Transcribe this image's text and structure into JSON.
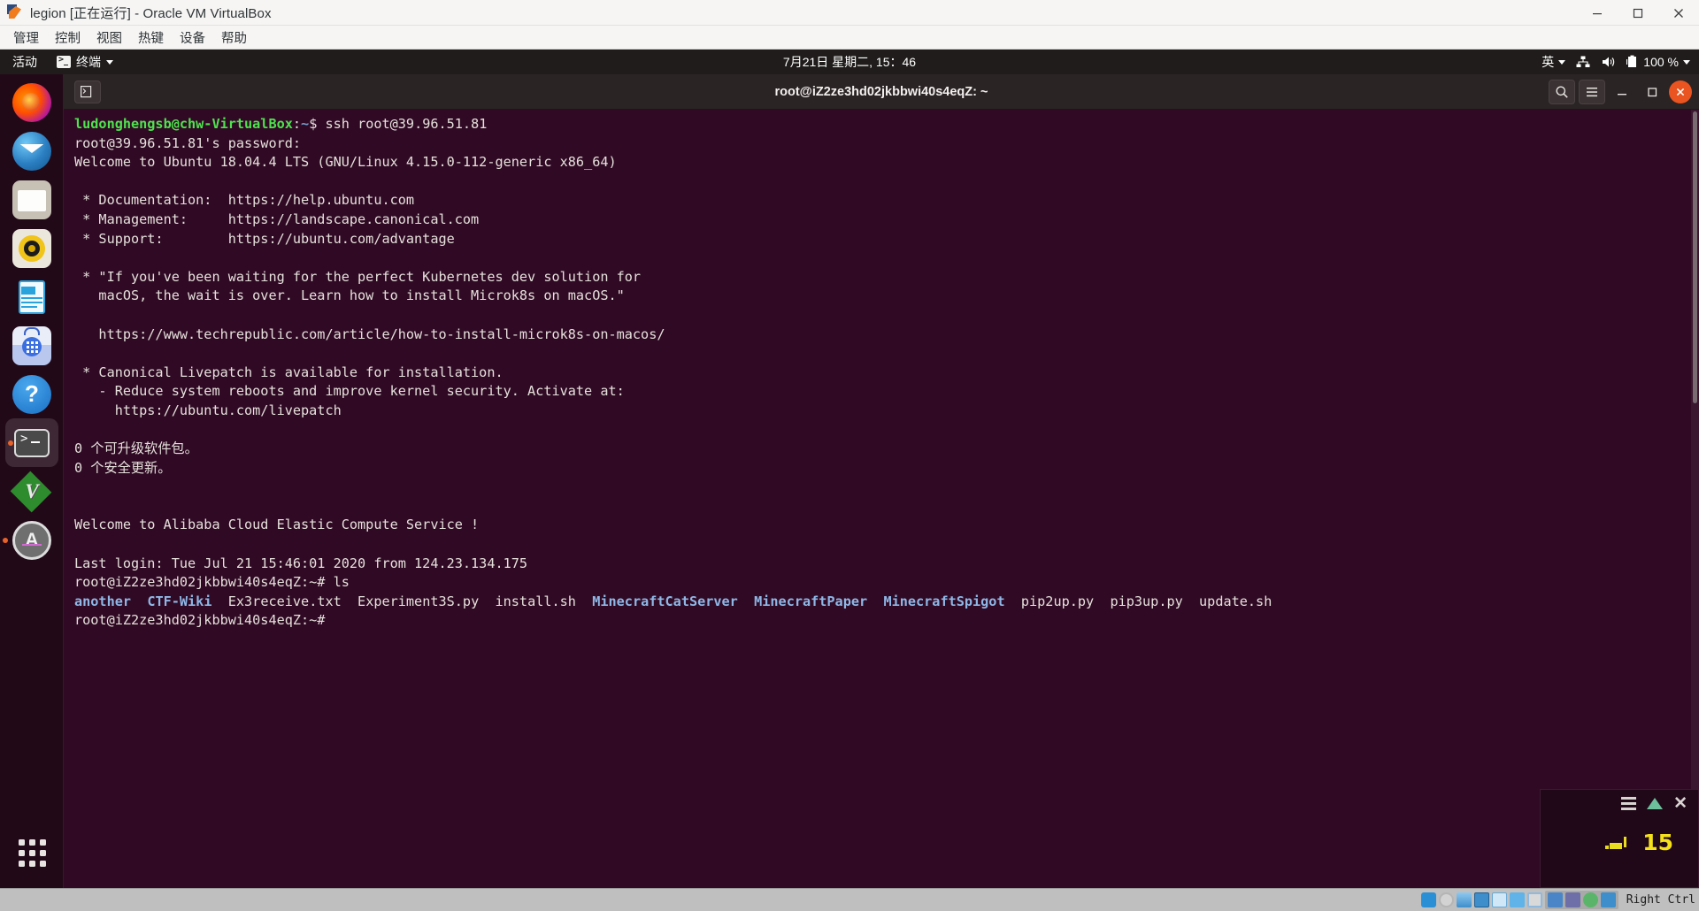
{
  "vbox": {
    "title": "legion [正在运行] - Oracle VM VirtualBox",
    "menu": [
      "管理",
      "控制",
      "视图",
      "热键",
      "设备",
      "帮助"
    ],
    "window_buttons": [
      {
        "name": "minimize-button",
        "label": "—"
      },
      {
        "name": "maximize-button",
        "label": "▢"
      },
      {
        "name": "close-button",
        "label": "✕"
      }
    ],
    "statusbar": {
      "icons": [
        "hard-disk-icon",
        "optical-disk-icon",
        "audio-icon",
        "network-icon",
        "usb-icon",
        "shared-folders-icon",
        "display-icon",
        "recording-icon",
        "virtualization-icon",
        "mouse-integration-icon",
        "keyboard-icon"
      ],
      "host_key": "Right Ctrl"
    }
  },
  "gnome_topbar": {
    "activities": "活动",
    "app_name": "终端",
    "app_icon": "terminal-icon",
    "clock": "7月21日 星期二, 15：46",
    "indicators": [
      {
        "name": "input-method-indicator",
        "label": "英",
        "icon": "chevron-down-icon"
      },
      {
        "name": "network-indicator",
        "label": "",
        "icon": "network-icon"
      },
      {
        "name": "volume-indicator",
        "label": "",
        "icon": "speaker-icon"
      },
      {
        "name": "battery-indicator",
        "label": "100 %",
        "icon": "battery-icon"
      }
    ]
  },
  "dock": {
    "items": [
      {
        "name": "firefox",
        "icon": "firefox-icon",
        "running": false
      },
      {
        "name": "thunderbird",
        "icon": "thunderbird-icon",
        "running": false
      },
      {
        "name": "files",
        "icon": "files-folder-icon",
        "running": false
      },
      {
        "name": "rhythmbox",
        "icon": "rhythmbox-icon",
        "running": false
      },
      {
        "name": "libreoffice-writer",
        "icon": "libreoffice-writer-icon",
        "running": false
      },
      {
        "name": "ubuntu-software",
        "icon": "ubuntu-software-icon",
        "running": false
      },
      {
        "name": "help",
        "icon": "help-question-icon",
        "running": false
      },
      {
        "name": "terminal",
        "icon": "terminal-prompt-icon",
        "running": true
      },
      {
        "name": "vim",
        "icon": "vim-icon",
        "running": false
      },
      {
        "name": "amule",
        "icon": "amule-icon",
        "running": true
      }
    ],
    "show_apps": "show-applications-icon"
  },
  "terminal": {
    "title": "root@iZ2ze3hd02jkbbwi40s4eqZ: ~",
    "tab_button": "new-tab-icon",
    "buttons": [
      {
        "name": "search-button",
        "icon": "search-icon"
      },
      {
        "name": "menu-button",
        "icon": "hamburger-icon"
      },
      {
        "name": "minimize-button",
        "icon": "minimize-icon"
      },
      {
        "name": "maximize-button",
        "icon": "maximize-icon"
      },
      {
        "name": "close-button",
        "icon": "close-icon"
      }
    ],
    "lines": [
      [
        {
          "t": "ludonghengsb@chw-VirtualBox",
          "c": "c-green"
        },
        {
          "t": ":",
          "c": "c-white"
        },
        {
          "t": "~",
          "c": "c-blue"
        },
        {
          "t": "$ ssh root@39.96.51.81",
          "c": "c-white"
        }
      ],
      [
        {
          "t": "root@39.96.51.81's password:",
          "c": "c-white"
        }
      ],
      [
        {
          "t": "Welcome to Ubuntu 18.04.4 LTS (GNU/Linux 4.15.0-112-generic x86_64)",
          "c": "c-white"
        }
      ],
      [
        {
          "t": "",
          "c": "c-white"
        }
      ],
      [
        {
          "t": " * Documentation:  https://help.ubuntu.com",
          "c": "c-white"
        }
      ],
      [
        {
          "t": " * Management:     https://landscape.canonical.com",
          "c": "c-white"
        }
      ],
      [
        {
          "t": " * Support:        https://ubuntu.com/advantage",
          "c": "c-white"
        }
      ],
      [
        {
          "t": "",
          "c": "c-white"
        }
      ],
      [
        {
          "t": " * \"If you've been waiting for the perfect Kubernetes dev solution for",
          "c": "c-white"
        }
      ],
      [
        {
          "t": "   macOS, the wait is over. Learn how to install Microk8s on macOS.\"",
          "c": "c-white"
        }
      ],
      [
        {
          "t": "",
          "c": "c-white"
        }
      ],
      [
        {
          "t": "   https://www.techrepublic.com/article/how-to-install-microk8s-on-macos/",
          "c": "c-white"
        }
      ],
      [
        {
          "t": "",
          "c": "c-white"
        }
      ],
      [
        {
          "t": " * Canonical Livepatch is available for installation.",
          "c": "c-white"
        }
      ],
      [
        {
          "t": "   - Reduce system reboots and improve kernel security. Activate at:",
          "c": "c-white"
        }
      ],
      [
        {
          "t": "     https://ubuntu.com/livepatch",
          "c": "c-white"
        }
      ],
      [
        {
          "t": "",
          "c": "c-white"
        }
      ],
      [
        {
          "t": "0 个可升级软件包。",
          "c": "c-white"
        }
      ],
      [
        {
          "t": "0 个安全更新。",
          "c": "c-white"
        }
      ],
      [
        {
          "t": "",
          "c": "c-white"
        }
      ],
      [
        {
          "t": "",
          "c": "c-white"
        }
      ],
      [
        {
          "t": "Welcome to Alibaba Cloud Elastic Compute Service !",
          "c": "c-white"
        }
      ],
      [
        {
          "t": "",
          "c": "c-white"
        }
      ],
      [
        {
          "t": "Last login: Tue Jul 21 15:46:01 2020 from 124.23.134.175",
          "c": "c-white"
        }
      ],
      [
        {
          "t": "root@iZ2ze3hd02jkbbwi40s4eqZ:~# ls",
          "c": "c-white"
        }
      ],
      [
        {
          "t": "another",
          "c": "c-lblue"
        },
        {
          "t": "  ",
          "c": "c-white"
        },
        {
          "t": "CTF-Wiki",
          "c": "c-lblue"
        },
        {
          "t": "  Ex3receive.txt  Experiment3S.py  install.sh  ",
          "c": "c-white"
        },
        {
          "t": "MinecraftCatServer",
          "c": "c-lblue"
        },
        {
          "t": "  ",
          "c": "c-white"
        },
        {
          "t": "MinecraftPaper",
          "c": "c-lblue"
        },
        {
          "t": "  ",
          "c": "c-white"
        },
        {
          "t": "MinecraftSpigot",
          "c": "c-lblue"
        },
        {
          "t": "  pip2up.py  pip3up.py  update.sh",
          "c": "c-white"
        }
      ],
      [
        {
          "t": "root@iZ2ze3hd02jkbbwi40s4eqZ:~#",
          "c": "c-white"
        }
      ]
    ]
  },
  "ime_panel": {
    "menu_icon": "hamburger-icon",
    "expand_icon": "triangle-up-icon",
    "close_icon": "close-icon",
    "keyboard_icon": "keyboard-icon",
    "count": "15"
  },
  "colors": {
    "terminal_bg": "#300a24",
    "accent_orange": "#e95420",
    "dir_blue": "#8fb7e6",
    "prompt_green": "#4ee24e"
  }
}
